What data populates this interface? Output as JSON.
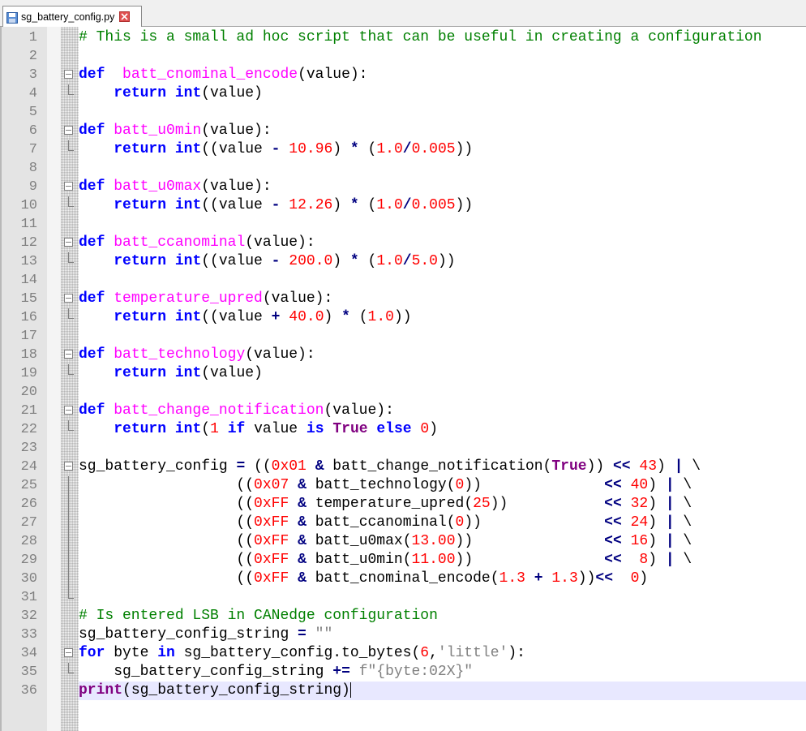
{
  "tab": {
    "title": "sg_battery_config.py",
    "save_icon": "save-icon",
    "close_icon": "close-icon"
  },
  "editor": {
    "line_numbers": [
      "1",
      "2",
      "3",
      "4",
      "5",
      "6",
      "7",
      "8",
      "9",
      "10",
      "11",
      "12",
      "13",
      "14",
      "15",
      "16",
      "17",
      "18",
      "19",
      "20",
      "21",
      "22",
      "23",
      "24",
      "25",
      "26",
      "27",
      "28",
      "29",
      "30",
      "31",
      "32",
      "33",
      "34",
      "35",
      "36"
    ],
    "active_line": 36,
    "lines": [
      [
        [
          "cm",
          "# This is a small ad hoc script that can be useful in creating a configuration"
        ]
      ],
      [],
      [
        [
          "kw",
          "def"
        ],
        [
          "",
          "  "
        ],
        [
          "fn",
          "batt_cnominal_encode"
        ],
        [
          "",
          "(value):"
        ]
      ],
      [
        [
          "",
          "    "
        ],
        [
          "kw",
          "return"
        ],
        [
          "",
          " "
        ],
        [
          "kw",
          "int"
        ],
        [
          "",
          "(value)"
        ]
      ],
      [],
      [
        [
          "kw",
          "def"
        ],
        [
          "",
          " "
        ],
        [
          "fn",
          "batt_u0min"
        ],
        [
          "",
          "(value):"
        ]
      ],
      [
        [
          "",
          "    "
        ],
        [
          "kw",
          "return"
        ],
        [
          "",
          " "
        ],
        [
          "kw",
          "int"
        ],
        [
          "",
          "((value "
        ],
        [
          "op",
          "-"
        ],
        [
          "",
          " "
        ],
        [
          "num",
          "10.96"
        ],
        [
          "",
          ") "
        ],
        [
          "op",
          "*"
        ],
        [
          "",
          " ("
        ],
        [
          "num",
          "1.0"
        ],
        [
          "op",
          "/"
        ],
        [
          "num",
          "0.005"
        ],
        [
          "",
          "))"
        ]
      ],
      [],
      [
        [
          "kw",
          "def"
        ],
        [
          "",
          " "
        ],
        [
          "fn",
          "batt_u0max"
        ],
        [
          "",
          "(value):"
        ]
      ],
      [
        [
          "",
          "    "
        ],
        [
          "kw",
          "return"
        ],
        [
          "",
          " "
        ],
        [
          "kw",
          "int"
        ],
        [
          "",
          "((value "
        ],
        [
          "op",
          "-"
        ],
        [
          "",
          " "
        ],
        [
          "num",
          "12.26"
        ],
        [
          "",
          ") "
        ],
        [
          "op",
          "*"
        ],
        [
          "",
          " ("
        ],
        [
          "num",
          "1.0"
        ],
        [
          "op",
          "/"
        ],
        [
          "num",
          "0.005"
        ],
        [
          "",
          "))"
        ]
      ],
      [],
      [
        [
          "kw",
          "def"
        ],
        [
          "",
          " "
        ],
        [
          "fn",
          "batt_ccanominal"
        ],
        [
          "",
          "(value):"
        ]
      ],
      [
        [
          "",
          "    "
        ],
        [
          "kw",
          "return"
        ],
        [
          "",
          " "
        ],
        [
          "kw",
          "int"
        ],
        [
          "",
          "((value "
        ],
        [
          "op",
          "-"
        ],
        [
          "",
          " "
        ],
        [
          "num",
          "200.0"
        ],
        [
          "",
          ") "
        ],
        [
          "op",
          "*"
        ],
        [
          "",
          " ("
        ],
        [
          "num",
          "1.0"
        ],
        [
          "op",
          "/"
        ],
        [
          "num",
          "5.0"
        ],
        [
          "",
          "))"
        ]
      ],
      [],
      [
        [
          "kw",
          "def"
        ],
        [
          "",
          " "
        ],
        [
          "fn",
          "temperature_upred"
        ],
        [
          "",
          "(value):"
        ]
      ],
      [
        [
          "",
          "    "
        ],
        [
          "kw",
          "return"
        ],
        [
          "",
          " "
        ],
        [
          "kw",
          "int"
        ],
        [
          "",
          "((value "
        ],
        [
          "op",
          "+"
        ],
        [
          "",
          " "
        ],
        [
          "num",
          "40.0"
        ],
        [
          "",
          ") "
        ],
        [
          "op",
          "*"
        ],
        [
          "",
          " ("
        ],
        [
          "num",
          "1.0"
        ],
        [
          "",
          "))"
        ]
      ],
      [],
      [
        [
          "kw",
          "def"
        ],
        [
          "",
          " "
        ],
        [
          "fn",
          "batt_technology"
        ],
        [
          "",
          "(value):"
        ]
      ],
      [
        [
          "",
          "    "
        ],
        [
          "kw",
          "return"
        ],
        [
          "",
          " "
        ],
        [
          "kw",
          "int"
        ],
        [
          "",
          "(value)"
        ]
      ],
      [],
      [
        [
          "kw",
          "def"
        ],
        [
          "",
          " "
        ],
        [
          "fn",
          "batt_change_notification"
        ],
        [
          "",
          "(value):"
        ]
      ],
      [
        [
          "",
          "    "
        ],
        [
          "kw",
          "return"
        ],
        [
          "",
          " "
        ],
        [
          "kw",
          "int"
        ],
        [
          "",
          "("
        ],
        [
          "num",
          "1"
        ],
        [
          "",
          " "
        ],
        [
          "kw",
          "if"
        ],
        [
          "",
          " value "
        ],
        [
          "kw",
          "is"
        ],
        [
          "",
          " "
        ],
        [
          "kw2",
          "True"
        ],
        [
          "",
          " "
        ],
        [
          "kw",
          "else"
        ],
        [
          "",
          " "
        ],
        [
          "num",
          "0"
        ],
        [
          "",
          ")"
        ]
      ],
      [],
      [
        [
          "",
          "sg_battery_config "
        ],
        [
          "op",
          "="
        ],
        [
          "",
          " (("
        ],
        [
          "num",
          "0x01"
        ],
        [
          "",
          " "
        ],
        [
          "op",
          "&"
        ],
        [
          "",
          " batt_change_notification("
        ],
        [
          "kw2",
          "True"
        ],
        [
          "",
          ")) "
        ],
        [
          "op",
          "<<"
        ],
        [
          "",
          " "
        ],
        [
          "num",
          "43"
        ],
        [
          "",
          ") "
        ],
        [
          "op",
          "|"
        ],
        [
          "",
          " \\"
        ]
      ],
      [
        [
          "",
          "                  (("
        ],
        [
          "num",
          "0x07"
        ],
        [
          "",
          " "
        ],
        [
          "op",
          "&"
        ],
        [
          "",
          " batt_technology("
        ],
        [
          "num",
          "0"
        ],
        [
          "",
          "))              "
        ],
        [
          "op",
          "<<"
        ],
        [
          "",
          " "
        ],
        [
          "num",
          "40"
        ],
        [
          "",
          ") "
        ],
        [
          "op",
          "|"
        ],
        [
          "",
          " \\"
        ]
      ],
      [
        [
          "",
          "                  (("
        ],
        [
          "num",
          "0xFF"
        ],
        [
          "",
          " "
        ],
        [
          "op",
          "&"
        ],
        [
          "",
          " temperature_upred("
        ],
        [
          "num",
          "25"
        ],
        [
          "",
          "))           "
        ],
        [
          "op",
          "<<"
        ],
        [
          "",
          " "
        ],
        [
          "num",
          "32"
        ],
        [
          "",
          ") "
        ],
        [
          "op",
          "|"
        ],
        [
          "",
          " \\"
        ]
      ],
      [
        [
          "",
          "                  (("
        ],
        [
          "num",
          "0xFF"
        ],
        [
          "",
          " "
        ],
        [
          "op",
          "&"
        ],
        [
          "",
          " batt_ccanominal("
        ],
        [
          "num",
          "0"
        ],
        [
          "",
          "))              "
        ],
        [
          "op",
          "<<"
        ],
        [
          "",
          " "
        ],
        [
          "num",
          "24"
        ],
        [
          "",
          ") "
        ],
        [
          "op",
          "|"
        ],
        [
          "",
          " \\"
        ]
      ],
      [
        [
          "",
          "                  (("
        ],
        [
          "num",
          "0xFF"
        ],
        [
          "",
          " "
        ],
        [
          "op",
          "&"
        ],
        [
          "",
          " batt_u0max("
        ],
        [
          "num",
          "13.00"
        ],
        [
          "",
          "))               "
        ],
        [
          "op",
          "<<"
        ],
        [
          "",
          " "
        ],
        [
          "num",
          "16"
        ],
        [
          "",
          ") "
        ],
        [
          "op",
          "|"
        ],
        [
          "",
          " \\"
        ]
      ],
      [
        [
          "",
          "                  (("
        ],
        [
          "num",
          "0xFF"
        ],
        [
          "",
          " "
        ],
        [
          "op",
          "&"
        ],
        [
          "",
          " batt_u0min("
        ],
        [
          "num",
          "11.00"
        ],
        [
          "",
          "))               "
        ],
        [
          "op",
          "<<"
        ],
        [
          "",
          "  "
        ],
        [
          "num",
          "8"
        ],
        [
          "",
          ") "
        ],
        [
          "op",
          "|"
        ],
        [
          "",
          " \\"
        ]
      ],
      [
        [
          "",
          "                  (("
        ],
        [
          "num",
          "0xFF"
        ],
        [
          "",
          " "
        ],
        [
          "op",
          "&"
        ],
        [
          "",
          " batt_cnominal_encode("
        ],
        [
          "num",
          "1.3"
        ],
        [
          "",
          " "
        ],
        [
          "op",
          "+"
        ],
        [
          "",
          " "
        ],
        [
          "num",
          "1.3"
        ],
        [
          "",
          "))"
        ],
        [
          "op",
          "<<"
        ],
        [
          "",
          "  "
        ],
        [
          "num",
          "0"
        ],
        [
          "",
          ")"
        ]
      ],
      [],
      [
        [
          "cm",
          "# Is entered LSB in CANedge configuration"
        ]
      ],
      [
        [
          "",
          "sg_battery_config_string "
        ],
        [
          "op",
          "="
        ],
        [
          "",
          " "
        ],
        [
          "str",
          "\"\""
        ]
      ],
      [
        [
          "kw",
          "for"
        ],
        [
          "",
          " byte "
        ],
        [
          "kw",
          "in"
        ],
        [
          "",
          " sg_battery_config.to_bytes("
        ],
        [
          "num",
          "6"
        ],
        [
          "",
          ","
        ],
        [
          "str",
          "'little'"
        ],
        [
          "",
          "):"
        ]
      ],
      [
        [
          "",
          "    sg_battery_config_string "
        ],
        [
          "op",
          "+="
        ],
        [
          "",
          " "
        ],
        [
          "str",
          "f\"{byte:02X}\""
        ]
      ],
      [
        [
          "kw2",
          "print"
        ],
        [
          "",
          "(sg_battery_config_string)"
        ]
      ]
    ],
    "fold_markers": [
      "",
      "",
      "box",
      "end",
      "",
      "box",
      "end",
      "",
      "box",
      "end",
      "",
      "box",
      "end",
      "",
      "box",
      "end",
      "",
      "box",
      "end",
      "",
      "box",
      "end",
      "",
      "box",
      "bar",
      "bar",
      "bar",
      "bar",
      "bar",
      "bar",
      "end",
      "",
      "",
      "box",
      "end",
      ""
    ]
  }
}
